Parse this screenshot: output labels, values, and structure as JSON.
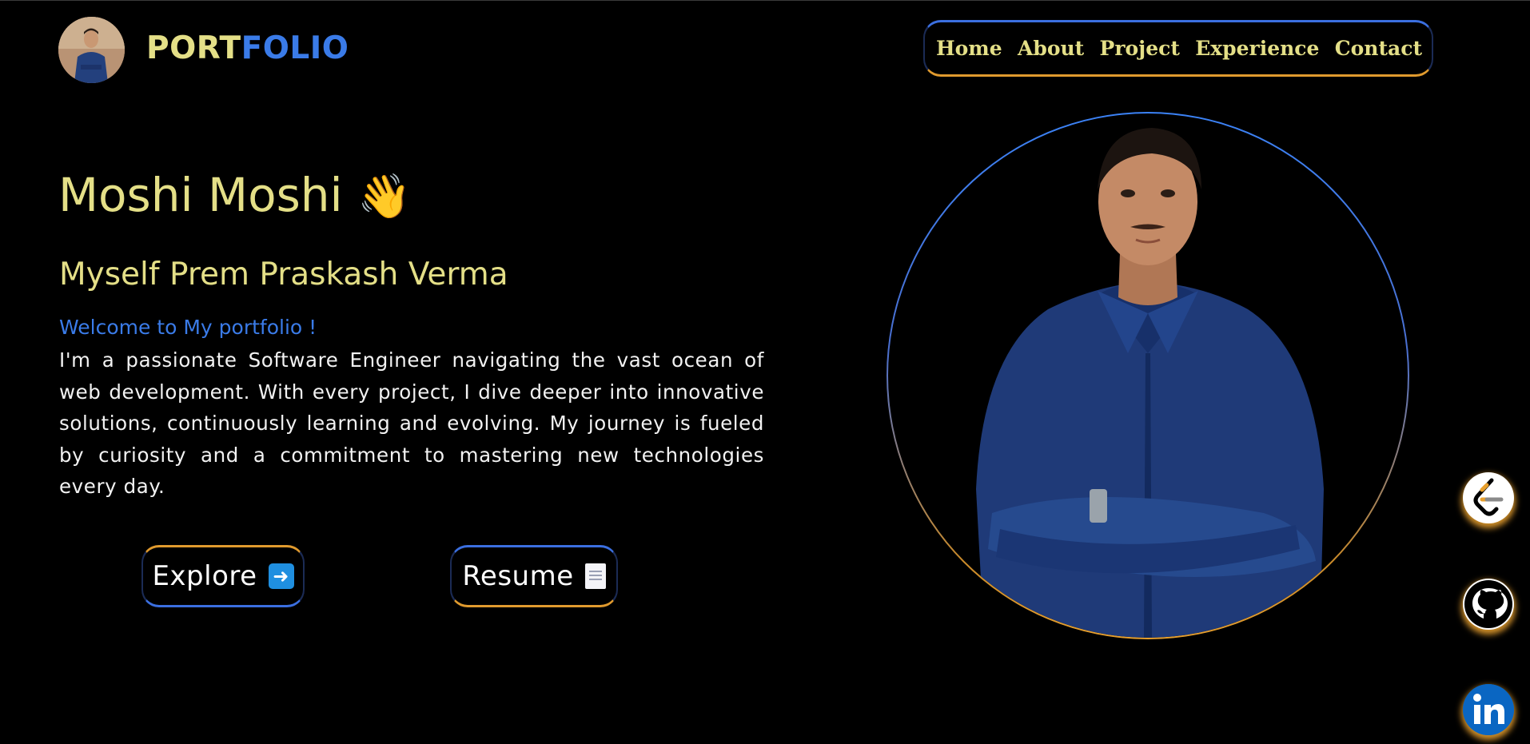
{
  "header": {
    "brand_part1": "PORT",
    "brand_part2": "FOLIO",
    "avatar_alt": "profile photo"
  },
  "nav": {
    "items": [
      {
        "label": "Home"
      },
      {
        "label": "About"
      },
      {
        "label": "Project"
      },
      {
        "label": "Experience"
      },
      {
        "label": "Contact"
      }
    ]
  },
  "hero": {
    "greeting": "Moshi Moshi",
    "greeting_emoji": "👋",
    "subtitle": "Myself Prem Praskash Verma",
    "welcome": "Welcome to My portfolio !",
    "bio": "I'm a passionate Software Engineer navigating the vast ocean of web development. With every project, I dive deeper into innovative solutions, continuously learning and evolving. My journey is fueled by curiosity and a commitment to mastering new technologies every day."
  },
  "buttons": {
    "explore_label": "Explore",
    "explore_icon": "right-arrow-icon",
    "resume_label": "Resume",
    "resume_icon": "document-icon"
  },
  "social": {
    "items": [
      {
        "icon": "leetcode-icon"
      },
      {
        "icon": "github-icon"
      },
      {
        "icon": "linkedin-icon"
      }
    ]
  },
  "colors": {
    "background": "#000000",
    "accent_yellow": "#e4df87",
    "accent_blue": "#3a7be8",
    "accent_orange": "#e09a2e",
    "text_white": "#f2f2f2"
  }
}
